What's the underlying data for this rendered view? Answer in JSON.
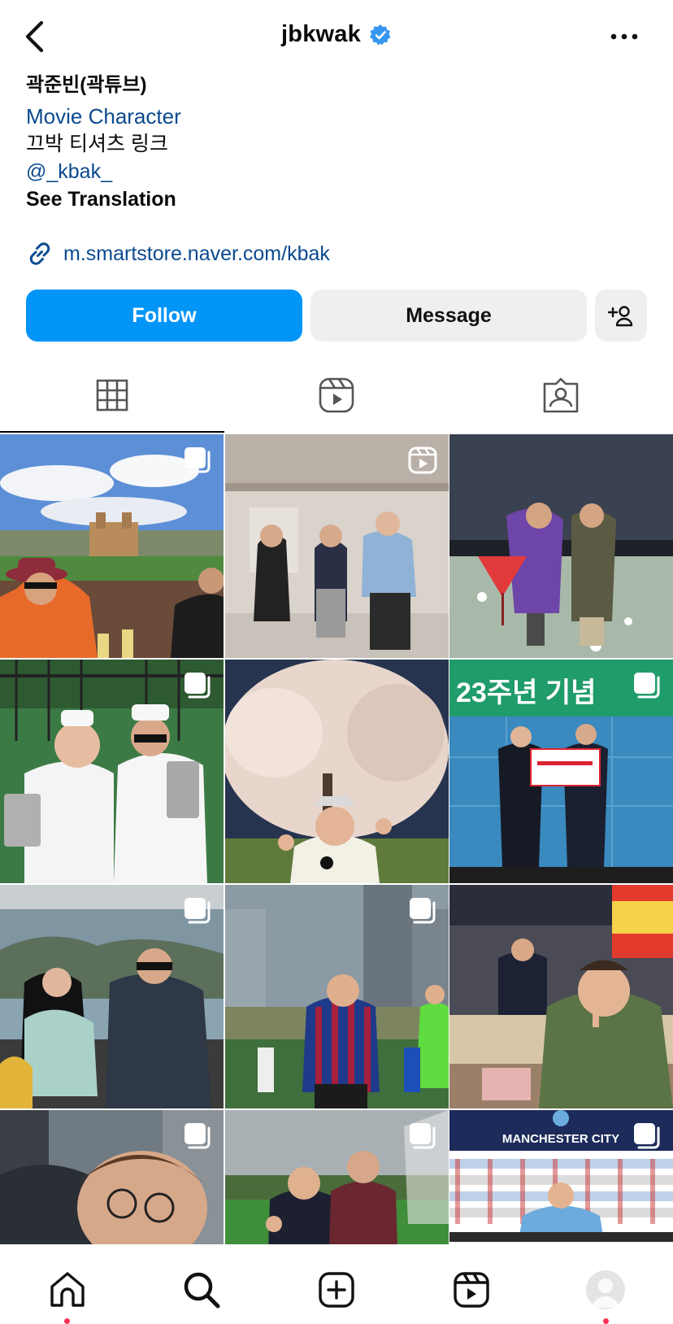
{
  "header": {
    "username": "jbkwak",
    "verified": true
  },
  "bio": {
    "name": "곽준빈(곽튜브)",
    "category": "Movie Character",
    "line1": "끄박 티셔츠 링크",
    "mention": "@_kbak_",
    "translate": "See Translation"
  },
  "link": {
    "text": "m.smartstore.naver.com/kbak"
  },
  "actions": {
    "follow_label": "Follow",
    "message_label": "Message"
  },
  "tabs": [
    "grid-icon",
    "reels-icon",
    "tagged-icon"
  ],
  "posts": [
    {
      "badge": "carousel",
      "scene": "Cusco plaza, two men at rooftop table"
    },
    {
      "badge": "reel",
      "scene": "three people dancing in studio"
    },
    {
      "badge": "none",
      "scene": "mirror room selfie with red umbrella"
    },
    {
      "badge": "carousel",
      "scene": "two men in white holding tin cans"
    },
    {
      "badge": "none",
      "scene": "man under cherry blossom tree"
    },
    {
      "badge": "carousel",
      "scene": "ceremony with award board"
    },
    {
      "badge": "carousel",
      "scene": "two people on boat"
    },
    {
      "badge": "carousel",
      "scene": "man in Barcelona jersey on field"
    },
    {
      "badge": "none",
      "scene": "man at market stall shushing"
    },
    {
      "badge": "carousel",
      "scene": "close-up man with glasses"
    },
    {
      "badge": "carousel",
      "scene": "two men on football pitch"
    },
    {
      "badge": "carousel",
      "scene": "Manchester City press room"
    }
  ],
  "post_texts": {
    "p6_sign": "23주년 기념",
    "p12_banner": "MANCHESTER CITY"
  },
  "colors": {
    "follow_bg": "#0095f6",
    "link_blue": "#0b4a8f",
    "nav_dot": "#ff2f55"
  },
  "bottom_nav": [
    "home-icon",
    "search-icon",
    "create-icon",
    "reels-icon",
    "profile-avatar"
  ]
}
